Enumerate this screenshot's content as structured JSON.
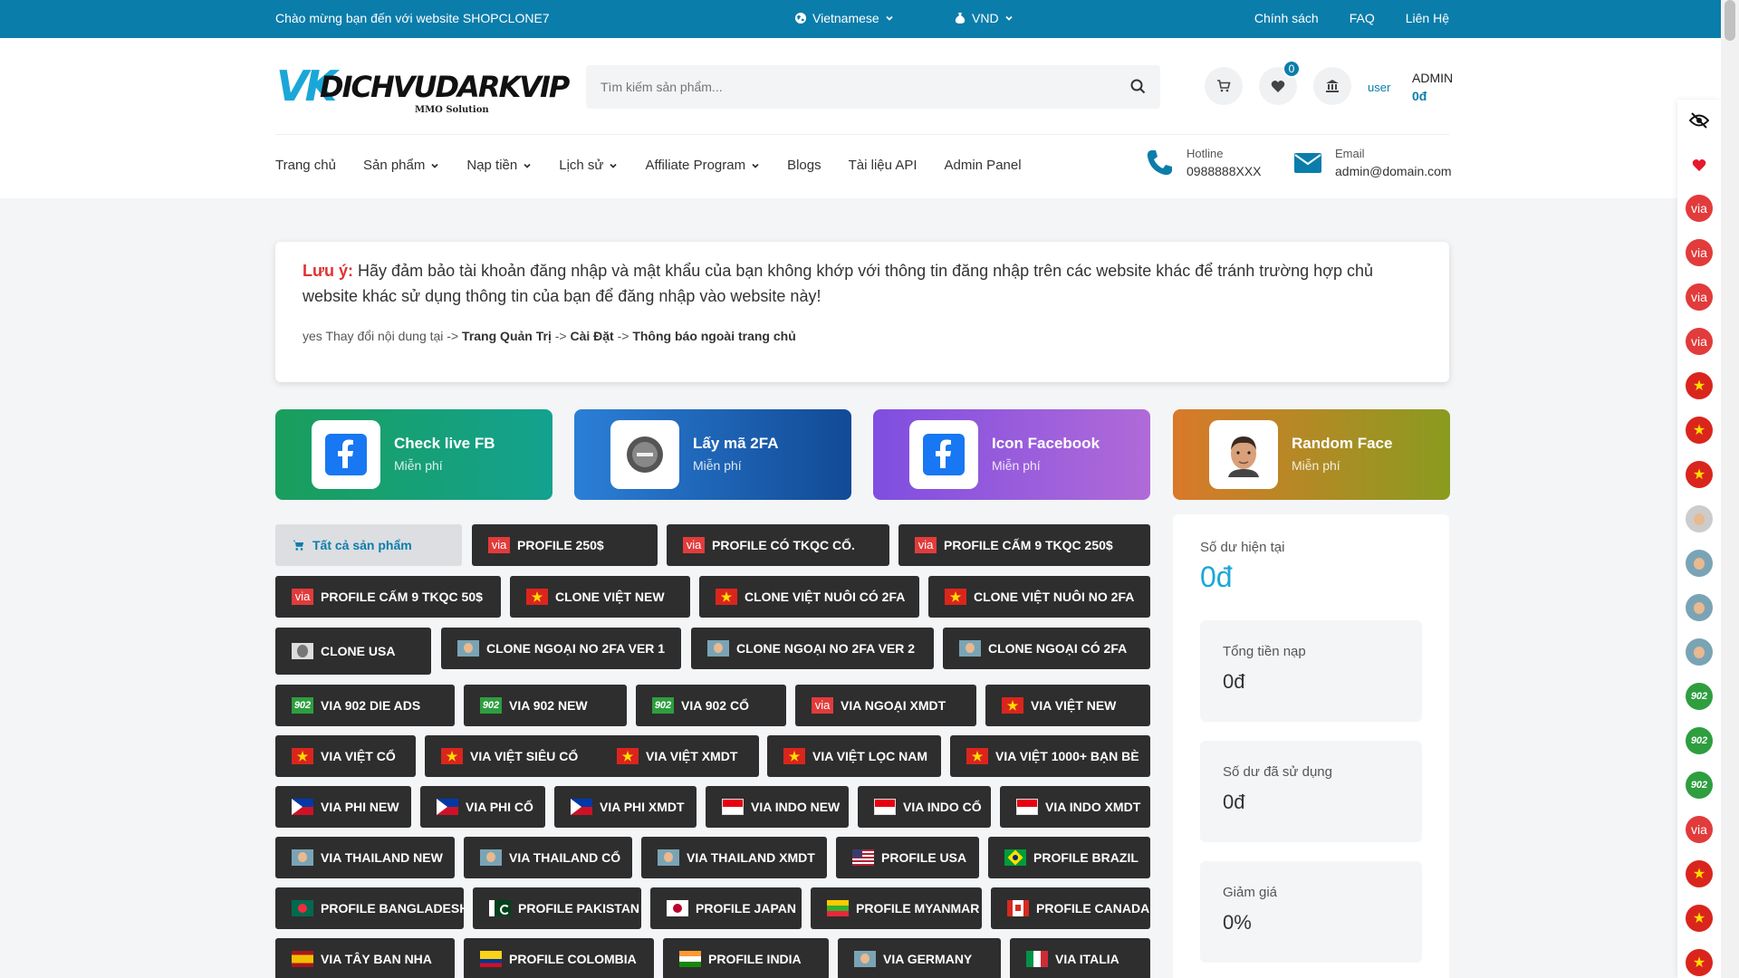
{
  "topbar": {
    "welcome": "Chào mừng bạn đến với website SHOPCLONE7",
    "language": "Vietnamese",
    "currency": "VND",
    "links": [
      "Chính sách",
      "FAQ",
      "Liên Hệ"
    ]
  },
  "logo": {
    "mark": "VK",
    "name": "DICHVUDARKVIP",
    "tagline": "MMO Solution"
  },
  "search": {
    "placeholder": "Tìm kiếm sản phẩm..."
  },
  "wishlist_count": "0",
  "user": {
    "avatar_alt": "user",
    "name": "ADMIN",
    "balance": "0đ"
  },
  "nav": [
    "Trang chủ",
    "Sản phẩm",
    "Nạp tiền",
    "Lịch sử",
    "Affiliate Program",
    "Blogs",
    "Tài liệu API",
    "Admin Panel"
  ],
  "contact": {
    "hotline_label": "Hotline",
    "hotline": "0988888XXX",
    "email_label": "Email",
    "email": "admin@domain.com"
  },
  "notice": {
    "label": "Lưu ý:",
    "text": "Hãy đảm bảo tài khoản đăng nhập và mật khẩu của bạn không khớp với thông tin đăng nhập trên các website khác để tránh trường hợp chủ website khác sử dụng thông tin của bạn để đăng nhập vào website này!",
    "img_alt": "yes",
    "sub_prefix": "Thay đổi nội dung tại ->",
    "path1": "Trang Quản Trị",
    "arrow": "->",
    "path2": "Cài Đặt",
    "path3": "Thông báo ngoài trang chủ"
  },
  "tools": [
    {
      "name": "Check live FB",
      "sub": "Miễn phí",
      "icon": "facebook-icon"
    },
    {
      "name": "Lấy mã 2FA",
      "sub": "Miễn phí",
      "icon": "2fa-icon"
    },
    {
      "name": "Icon Facebook",
      "sub": "Miễn phí",
      "icon": "facebook-icon"
    },
    {
      "name": "Random Face",
      "sub": "Miễn phí",
      "icon": "face-icon"
    }
  ],
  "categories": [
    "Tất cả sản phẩm",
    "PROFILE 250$",
    "PROFILE CÓ TKQC CỔ.",
    "PROFILE CẤM 9 TKQC 250$",
    "PROFILE CẤM 9 TKQC 50$",
    "CLONE VIỆT NEW",
    "CLONE VIỆT NUÔI CÓ 2FA",
    "CLONE VIỆT NUÔI NO 2FA",
    "CLONE USA",
    "CLONE NGOẠI NO 2FA VER 1",
    "CLONE NGOẠI NO 2FA VER 2",
    "CLONE NGOẠI CÓ 2FA",
    "VIA 902 DIE ADS",
    "VIA 902 NEW",
    "VIA 902 CỔ",
    "VIA NGOẠI XMDT",
    "VIA VIỆT NEW",
    "VIA VIỆT CỔ",
    "VIA VIỆT SIÊU CỔ",
    "VIA VIỆT XMDT",
    "VIA VIỆT LỌC NAM",
    "VIA VIỆT 1000+ BẠN BÈ",
    "VIA PHI NEW",
    "VIA PHI CỔ",
    "VIA PHI XMDT",
    "VIA INDO NEW",
    "VIA INDO CỔ",
    "VIA INDO XMDT",
    "VIA THAILAND NEW",
    "VIA THAILAND CỔ",
    "VIA THAILAND XMDT",
    "PROFILE USA",
    "PROFILE BRAZIL",
    "PROFILE BANGLADESH",
    "PROFILE PAKISTAN",
    "PROFILE JAPAN",
    "PROFILE MYANMAR",
    "PROFILE CANADA",
    "VIA TÂY BAN NHA",
    "PROFILE COLOMBIA",
    "PROFILE INDIA",
    "VIA GERMANY",
    "VIA ITALIA"
  ],
  "flag_text": {
    "via": "via",
    "vn": "★",
    "n902": "902"
  },
  "balance": {
    "current_label": "Số dư hiện tại",
    "current": "0đ",
    "total_label": "Tổng tiền nạp",
    "total": "0đ",
    "used_label": "Số dư đã sử dụng",
    "used": "0đ",
    "discount_label": "Giảm giá",
    "discount": "0%"
  },
  "colors": {
    "primary": "#0b7dab",
    "accent": "#1aa7d8",
    "warning": "#e03131",
    "button": "#2e2e2e"
  }
}
